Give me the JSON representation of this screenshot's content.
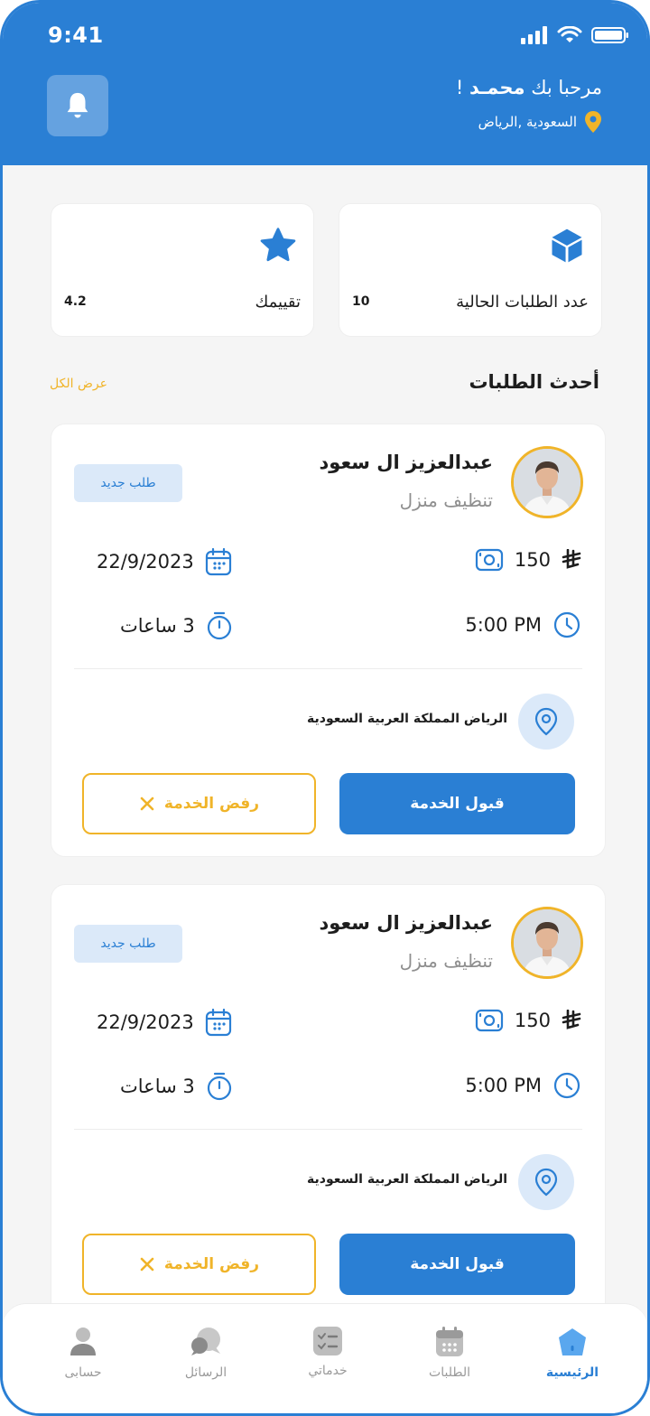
{
  "status_bar": {
    "time": "9:41"
  },
  "header": {
    "greeting_prefix": "مرحبا بك",
    "user_name": "محمـد",
    "greeting_suffix": "!",
    "location": "السعودية ,الرياض"
  },
  "stats": [
    {
      "label": "عدد الطلبات الحالية",
      "value": "10",
      "icon": "cube-icon"
    },
    {
      "label": "تقييمك",
      "value": "4.2",
      "icon": "star-icon"
    }
  ],
  "section": {
    "title": "أحدث الطلبات",
    "view_all": "عرض الكل"
  },
  "requests": [
    {
      "name": "عبدالعزيز ال سعود",
      "service": "تنظيف منزل",
      "badge": "طلب جديد",
      "price": "150",
      "date": "22/9/2023",
      "time": "5:00 PM",
      "duration": "3 ساعات",
      "location": "الرياض المملكة العربية السعودية",
      "accept_label": "قبول الخدمة",
      "reject_label": "رفض الخدمة"
    },
    {
      "name": "عبدالعزيز ال سعود",
      "service": "تنظيف منزل",
      "badge": "طلب جديد",
      "price": "150",
      "date": "22/9/2023",
      "time": "5:00 PM",
      "duration": "3 ساعات",
      "location": "الرياض المملكة العربية السعودية",
      "accept_label": "قبول الخدمة",
      "reject_label": "رفض الخدمة"
    }
  ],
  "nav": [
    {
      "label": "الرئيسية",
      "icon": "home-icon",
      "active": true
    },
    {
      "label": "الطلبات",
      "icon": "calendar-icon",
      "active": false
    },
    {
      "label": "خدماتي",
      "icon": "checklist-icon",
      "active": false
    },
    {
      "label": "الرسائل",
      "icon": "chat-icon",
      "active": false
    },
    {
      "label": "حسابى",
      "icon": "user-icon",
      "active": false
    }
  ],
  "colors": {
    "primary": "#2a7fd4",
    "accent": "#f0b429",
    "badge_bg": "#dbe9f9"
  }
}
